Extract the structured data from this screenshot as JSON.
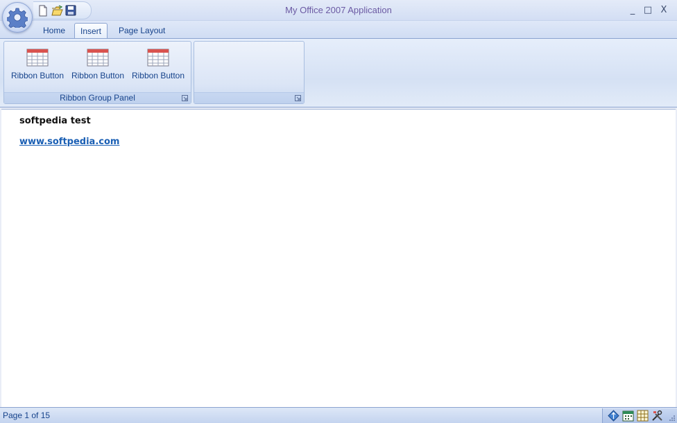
{
  "window": {
    "title": "My Office 2007 Application",
    "minimize_glyph": "_",
    "maximize_glyph": "□",
    "close_glyph": "X"
  },
  "quick_access": [
    {
      "name": "new-document-icon"
    },
    {
      "name": "open-folder-icon"
    },
    {
      "name": "save-icon"
    }
  ],
  "tabs": [
    {
      "label": "Home",
      "active": false
    },
    {
      "label": "Insert",
      "active": true
    },
    {
      "label": "Page Layout",
      "active": false
    }
  ],
  "ribbon": {
    "groups": [
      {
        "label": "Ribbon Group Panel",
        "buttons": [
          {
            "label": "Ribbon Button",
            "icon": "table-icon"
          },
          {
            "label": "Ribbon Button",
            "icon": "table-icon"
          },
          {
            "label": "Ribbon Button",
            "icon": "table-icon"
          }
        ]
      },
      {
        "label": "",
        "buttons": []
      }
    ]
  },
  "document": {
    "title": "softpedia test",
    "link": "www.softpedia.com"
  },
  "statusbar": {
    "text": "Page 1 of 15",
    "icons": [
      "navigation-icon",
      "calendar-icon",
      "grid-icon",
      "tools-icon"
    ]
  },
  "colors": {
    "accent": "#15428b",
    "title_text": "#6b5aa3",
    "link": "#1a5fb4"
  }
}
